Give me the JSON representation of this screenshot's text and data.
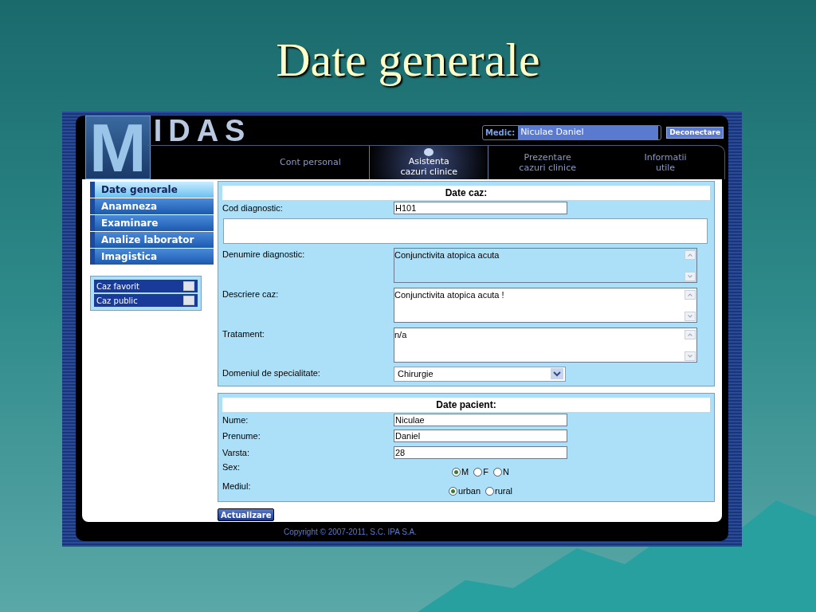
{
  "slide_title": "Date generale",
  "app": {
    "logo": {
      "initial": "M",
      "rest": "IDAS"
    },
    "doctor": {
      "label": "Medic:",
      "name": "Niculae Daniel"
    },
    "logout_button": "Deconectare",
    "nav": [
      {
        "lines": [
          "Cont personal"
        ],
        "selected": false
      },
      {
        "lines": [
          "Asistenta",
          "cazuri clinice"
        ],
        "selected": true
      },
      {
        "lines": [
          "Prezentare",
          "cazuri clinice"
        ],
        "selected": false
      },
      {
        "lines": [
          "Informatii",
          "utile"
        ],
        "selected": false
      }
    ],
    "sidebar": {
      "items": [
        {
          "label": "Date generale",
          "selected": true
        },
        {
          "label": "Anamneza",
          "selected": false
        },
        {
          "label": "Examinare",
          "selected": false
        },
        {
          "label": "Analize laborator",
          "selected": false
        },
        {
          "label": "Imagistica",
          "selected": false
        }
      ],
      "options": [
        {
          "label": "Caz favorit",
          "checked": false
        },
        {
          "label": "Caz public",
          "checked": false
        }
      ]
    },
    "case_section": {
      "title": "Date caz:",
      "fields": [
        {
          "kind": "input",
          "label": "Cod diagnostic:",
          "value": "H101"
        },
        {
          "kind": "blank"
        },
        {
          "kind": "textarea",
          "label": "Denumire diagnostic:",
          "value": "Conjunctivita atopica acuta",
          "disabled": true
        },
        {
          "kind": "textarea",
          "label": "Descriere caz:",
          "value": "Conjunctivita atopica acuta !",
          "disabled": false
        },
        {
          "kind": "textarea",
          "label": "Tratament:",
          "value": "n/a",
          "disabled": false
        },
        {
          "kind": "select",
          "label": "Domeniul de specialitate:",
          "value": "Chirurgie"
        }
      ]
    },
    "patient_section": {
      "title": "Date pacient:",
      "fields": [
        {
          "kind": "input",
          "label": "Nume:",
          "value": "Niculae"
        },
        {
          "kind": "input",
          "label": "Prenume:",
          "value": "Daniel"
        },
        {
          "kind": "input",
          "label": "Varsta:",
          "value": "28"
        },
        {
          "kind": "radio",
          "label": "Sex:",
          "options": [
            {
              "label": "M",
              "selected": true
            },
            {
              "label": "F",
              "selected": false
            },
            {
              "label": "N",
              "selected": false
            }
          ]
        },
        {
          "kind": "radio",
          "label": "Mediul:",
          "options": [
            {
              "label": "urban",
              "selected": true
            },
            {
              "label": "rural",
              "selected": false
            }
          ]
        }
      ]
    },
    "update_button": "Actualizare",
    "copyright": "Copyright © 2007-2011, S.C. IPA S.A."
  }
}
